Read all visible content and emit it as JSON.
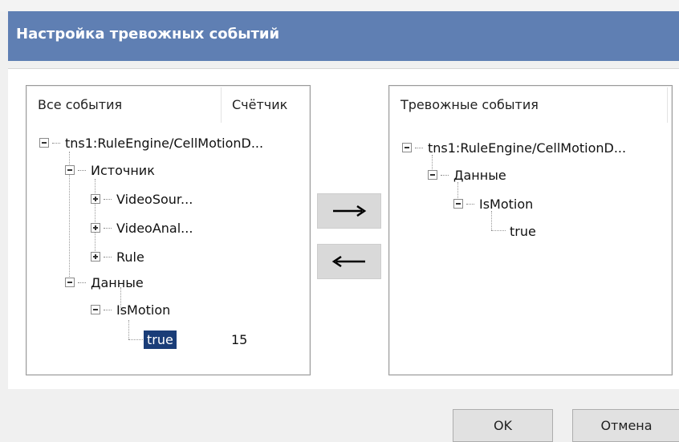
{
  "dialog": {
    "title": "Настройка тревожных событий"
  },
  "left_panel": {
    "columns": [
      "Все события",
      "Счётчик"
    ],
    "tree": {
      "root": "tns1:RuleEngine/CellMotionD...",
      "source_group": "Источник",
      "source_items": [
        "VideoSour...",
        "VideoAnal...",
        "Rule"
      ],
      "data_group": "Данные",
      "data_item": "IsMotion",
      "value": "true",
      "count": "15"
    }
  },
  "right_panel": {
    "header": "Тревожные события",
    "tree": {
      "root": "tns1:RuleEngine/CellMotionD...",
      "data_group": "Данные",
      "data_item": "IsMotion",
      "value": "true"
    }
  },
  "buttons": {
    "add_icon": "arrow-right-icon",
    "remove_icon": "arrow-left-icon",
    "ok": "OK",
    "cancel": "Отмена"
  }
}
